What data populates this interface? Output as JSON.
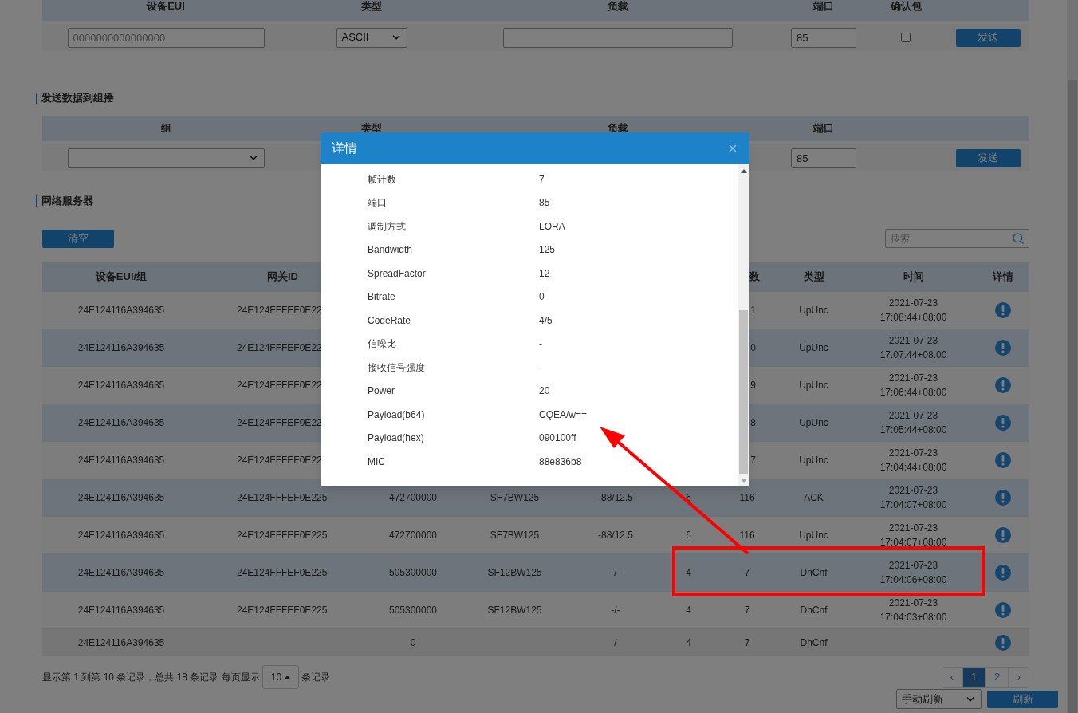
{
  "unicast_form": {
    "columns": [
      "设备EUI",
      "类型",
      "负载",
      "端口",
      "确认包"
    ],
    "eui_placeholder": "0000000000000000",
    "type_value": "ASCII",
    "port_value": "85",
    "confirm_checked": false,
    "send_button": "发送"
  },
  "multicast_form": {
    "title": "发送数据到组播",
    "columns": [
      "组",
      "类型",
      "负载",
      "端口"
    ],
    "port_value": "85",
    "send_button": "发送"
  },
  "network_server": {
    "title": "网络服务器",
    "clear_button": "清空",
    "search_placeholder": "搜索",
    "table": {
      "header": {
        "column_1": "设备EUI/组",
        "column_2": "网关ID",
        "column_7": "数",
        "column_8": "类型",
        "column_9": "时间",
        "column_10": "详情"
      },
      "rows": [
        {
          "column_1": "24E124116A394635",
          "column_2": "24E124FFFEF0E22",
          "column_7": "1",
          "column_8": "UpUnc",
          "column_9": "2021-07-23 17:08:44+08:00"
        },
        {
          "column_1": "24E124116A394635",
          "column_2": "24E124FFFEF0E22",
          "column_7": "0",
          "column_8": "UpUnc",
          "column_9": "2021-07-23 17:07:44+08:00"
        },
        {
          "column_1": "24E124116A394635",
          "column_2": "24E124FFFEF0E22",
          "column_7": "9",
          "column_8": "UpUnc",
          "column_9": "2021-07-23 17:06:44+08:00"
        },
        {
          "column_1": "24E124116A394635",
          "column_2": "24E124FFFEF0E22",
          "column_7": "8",
          "column_8": "UpUnc",
          "column_9": "2021-07-23 17:05:44+08:00"
        },
        {
          "column_1": "24E124116A394635",
          "column_2": "24E124FFFEF0E22",
          "column_7": "7",
          "column_8": "UpUnc",
          "column_9": "2021-07-23 17:04:44+08:00"
        },
        {
          "column_1": "24E124116A394635",
          "column_2": "24E124FFFEF0E225",
          "column_3": "472700000",
          "column_4": "SF7BW125",
          "column_5": "-88/12.5",
          "column_6": "6",
          "column_7": "116",
          "column_8": "ACK",
          "column_9": "2021-07-23 17:04:07+08:00"
        },
        {
          "column_1": "24E124116A394635",
          "column_2": "24E124FFFEF0E225",
          "column_3": "472700000",
          "column_4": "SF7BW125",
          "column_5": "-88/12.5",
          "column_6": "6",
          "column_7": "116",
          "column_8": "UpUnc",
          "column_9": "2021-07-23 17:04:07+08:00"
        },
        {
          "column_1": "24E124116A394635",
          "column_2": "24E124FFFEF0E225",
          "column_3": "505300000",
          "column_4": "SF12BW125",
          "column_5": "-/-",
          "column_6": "4",
          "column_7": "7",
          "column_8": "DnCnf",
          "column_9": "2021-07-23 17:04:06+08:00"
        },
        {
          "column_1": "24E124116A394635",
          "column_2": "24E124FFFEF0E225",
          "column_3": "505300000",
          "column_4": "SF12BW125",
          "column_5": "-/-",
          "column_6": "4",
          "column_7": "7",
          "column_8": "DnCnf",
          "column_9": "2021-07-23 17:04:03+08:00"
        },
        {
          "column_1": "24E124116A394635",
          "column_3": "0",
          "column_5": "/",
          "column_6": "4",
          "column_7": "7",
          "column_8": "DnCnf"
        }
      ]
    },
    "pagination": {
      "summary": "显示第 1 到第 10 条记录，总共 18 条记录 每页显示",
      "page_size": "10",
      "summary_after": "条记录",
      "prev": "‹",
      "next": "›",
      "pages": [
        {
          "label": "1",
          "selected": true
        },
        {
          "label": "2",
          "selected": false
        }
      ]
    },
    "refresh_mode": "手动刷新",
    "refresh_button": "刷新"
  },
  "dialog": {
    "title": "详情",
    "fields": [
      {
        "label": "帧计数",
        "value": "7"
      },
      {
        "label": "端口",
        "value": "85"
      },
      {
        "label": "调制方式",
        "value": "LORA"
      },
      {
        "label": "Bandwidth",
        "value": "125"
      },
      {
        "label": "SpreadFactor",
        "value": "12"
      },
      {
        "label": "Bitrate",
        "value": "0"
      },
      {
        "label": "CodeRate",
        "value": "4/5"
      },
      {
        "label": "信噪比",
        "value": "-"
      },
      {
        "label": "接收信号强度",
        "value": "-"
      },
      {
        "label": "Power",
        "value": "20"
      },
      {
        "label": "Payload(b64)",
        "value": "CQEA/w=="
      },
      {
        "label": "Payload(hex)",
        "value": "090100ff"
      },
      {
        "label": "MIC",
        "value": "88e836b8"
      }
    ]
  }
}
